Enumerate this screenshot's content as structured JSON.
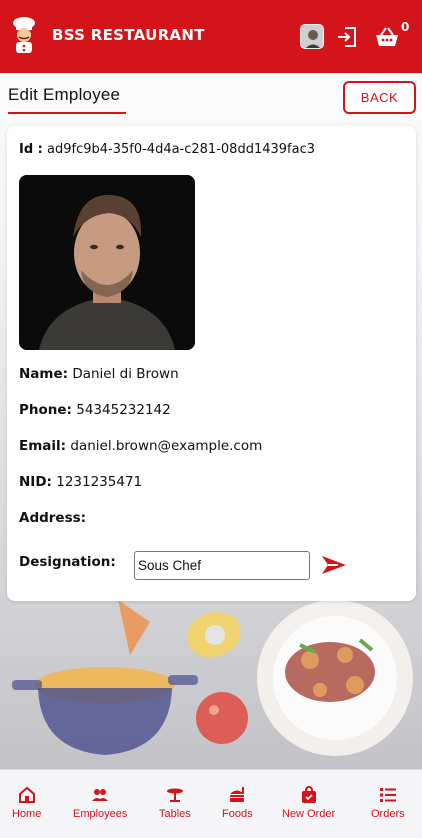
{
  "header": {
    "title": "BSS RESTAURANT",
    "cart_count": "0",
    "icons": [
      "chef-logo-icon",
      "user-avatar",
      "logout-icon",
      "basket-icon"
    ],
    "brand_color": "#d4141b"
  },
  "page": {
    "title": "Edit Employee",
    "back_label": "BACK"
  },
  "employee": {
    "id_label": "Id :",
    "id_value": "ad9fc9b4-35f0-4d4a-c281-08dd1439fac3",
    "name_label": "Name:",
    "name_value": "Daniel di Brown",
    "phone_label": "Phone:",
    "phone_value": "54345232142",
    "email_label": "Email:",
    "email_value": "daniel.brown@example.com",
    "nid_label": "NID:",
    "nid_value": "1231235471",
    "address_label": "Address:",
    "address_value": "",
    "designation_label": "Designation:",
    "designation_value": "Sous Chef"
  },
  "nav": {
    "home": "Home",
    "employees": "Employees",
    "tables": "Tables",
    "foods": "Foods",
    "new_order": "New Order",
    "orders": "Orders"
  }
}
